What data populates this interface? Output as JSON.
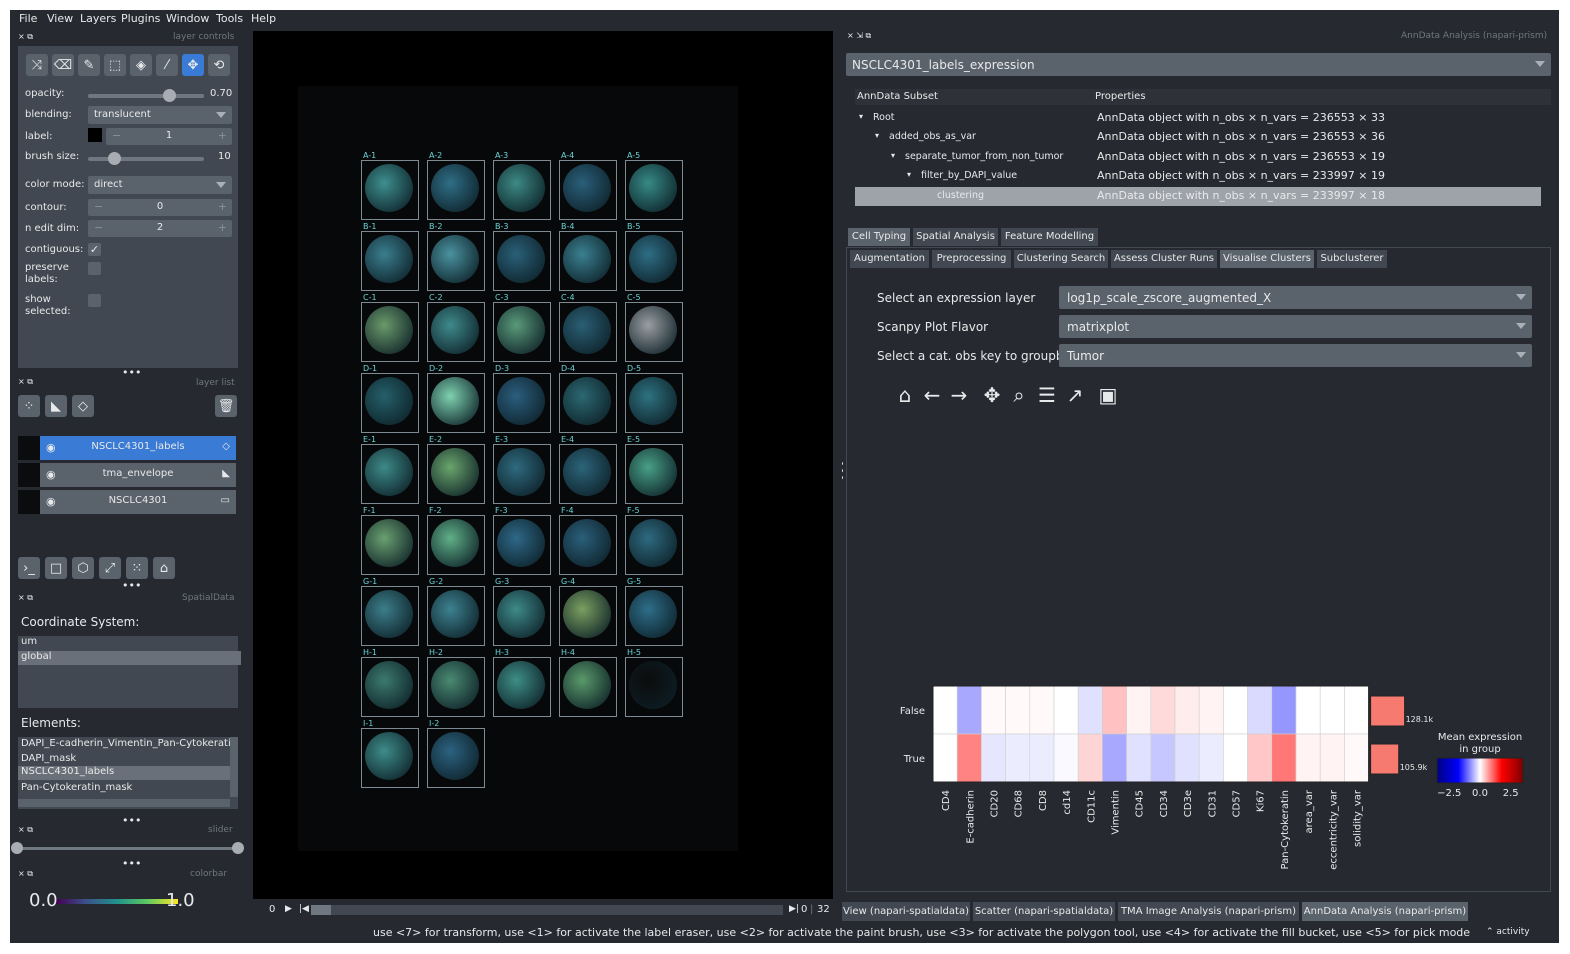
{
  "menu": [
    "File",
    "View",
    "Layers",
    "Plugins",
    "Window",
    "Tools",
    "Help"
  ],
  "layer_controls": {
    "title": "layer controls",
    "opacity_label": "opacity:",
    "opacity_value": "0.70",
    "opacity_fraction": 0.7,
    "blending_label": "blending:",
    "blending_value": "translucent",
    "label_label": "label:",
    "label_value": "1",
    "brush_label": "brush size:",
    "brush_value": "10",
    "brush_fraction": 0.22,
    "color_mode_label": "color mode:",
    "color_mode_value": "direct",
    "contour_label": "contour:",
    "contour_value": "0",
    "ndim_label": "n edit dim:",
    "ndim_value": "2",
    "contiguous_label": "contiguous:",
    "preserve_label": "preserve labels:",
    "show_selected_label": "show selected:",
    "minus": "−",
    "plus": "+",
    "check": "✓"
  },
  "layer_list": {
    "title": "layer list",
    "layers": [
      {
        "name": "NSCLC4301_labels",
        "selected": true
      },
      {
        "name": "tma_envelope",
        "selected": false
      },
      {
        "name": "NSCLC4301",
        "selected": false
      }
    ]
  },
  "spatialdata": {
    "title": "SpatialData",
    "coord_label": "Coordinate System:",
    "coords": [
      "um",
      "global"
    ],
    "elements_label": "Elements:",
    "elements": [
      "DAPI_E-cadherin_Vimentin_Pan-Cytokerati",
      "DAPI_mask",
      "NSCLC4301_labels",
      "Pan-Cytokeratin_mask"
    ]
  },
  "slider_title": "slider",
  "colorbar": {
    "title": "colorbar",
    "min": "0.0",
    "max": "1.0"
  },
  "canvas": {
    "cores": [
      {
        "l": "A-1",
        "c": "#3e8f8f"
      },
      {
        "l": "A-2",
        "c": "#2f6e86"
      },
      {
        "l": "A-3",
        "c": "#3c8a84"
      },
      {
        "l": "A-4",
        "c": "#2a5f7a"
      },
      {
        "l": "A-5",
        "c": "#368a86"
      },
      {
        "l": "B-1",
        "c": "#3a7e8e"
      },
      {
        "l": "B-2",
        "c": "#4a92a0"
      },
      {
        "l": "B-3",
        "c": "#2a6078"
      },
      {
        "l": "B-4",
        "c": "#3a8090"
      },
      {
        "l": "B-5",
        "c": "#2e6e86"
      },
      {
        "l": "C-1",
        "c": "#6a9a6a"
      },
      {
        "l": "C-2",
        "c": "#3f8a8c"
      },
      {
        "l": "C-3",
        "c": "#5a9a7a"
      },
      {
        "l": "C-4",
        "c": "#2a5f74"
      },
      {
        "l": "C-5",
        "c": "#9a9ea2"
      },
      {
        "l": "D-1",
        "c": "#25606a"
      },
      {
        "l": "D-2",
        "c": "#7ed1b0"
      },
      {
        "l": "D-3",
        "c": "#2b5e7e"
      },
      {
        "l": "D-4",
        "c": "#2c6872"
      },
      {
        "l": "D-5",
        "c": "#2e7280"
      },
      {
        "l": "E-1",
        "c": "#3d8a88"
      },
      {
        "l": "E-2",
        "c": "#6aa56c"
      },
      {
        "l": "E-3",
        "c": "#2e6a7e"
      },
      {
        "l": "E-4",
        "c": "#2c647a"
      },
      {
        "l": "E-5",
        "c": "#48a086"
      },
      {
        "l": "F-1",
        "c": "#6aa070"
      },
      {
        "l": "F-2",
        "c": "#60b088"
      },
      {
        "l": "F-3",
        "c": "#2e6888"
      },
      {
        "l": "F-4",
        "c": "#2a5f7a"
      },
      {
        "l": "F-5",
        "c": "#2e6a80"
      },
      {
        "l": "G-1",
        "c": "#3c7e8a"
      },
      {
        "l": "G-2",
        "c": "#3d8290"
      },
      {
        "l": "G-3",
        "c": "#3e8a8a"
      },
      {
        "l": "G-4",
        "c": "#7aa060"
      },
      {
        "l": "G-5",
        "c": "#2e6e8a"
      },
      {
        "l": "H-1",
        "c": "#3c7a6e"
      },
      {
        "l": "H-2",
        "c": "#4a8a72"
      },
      {
        "l": "H-3",
        "c": "#3e8e86"
      },
      {
        "l": "H-4",
        "c": "#5a9a6a"
      },
      {
        "l": "H-5",
        "c": "#0c0c0c"
      },
      {
        "l": "I-1",
        "c": "#3e8c8a"
      },
      {
        "l": "I-2",
        "c": "#2c6280"
      }
    ]
  },
  "dims": {
    "left_value": "0",
    "right_value": "0",
    "total": "32"
  },
  "right": {
    "title": "AnnData Analysis (napari-prism)",
    "selector": "NSCLC4301_labels_expression",
    "tree_headers": [
      "AnnData Subset",
      "Properties"
    ],
    "tree": [
      {
        "key": "Root",
        "prop": "AnnData object with n_obs × n_vars = 236553 × 33"
      },
      {
        "key": "added_obs_as_var",
        "prop": "AnnData object with n_obs × n_vars = 236553 × 36"
      },
      {
        "key": "separate_tumor_from_non_tumor",
        "prop": "AnnData object with n_obs × n_vars = 236553 × 19"
      },
      {
        "key": "filter_by_DAPI_value",
        "prop": "AnnData object with n_obs × n_vars = 233997 × 19"
      },
      {
        "key": "clustering",
        "prop": "AnnData object with n_obs × n_vars = 233997 × 18"
      }
    ],
    "tabs1": [
      "Cell Typing",
      "Spatial Analysis",
      "Feature Modelling"
    ],
    "tabs2": [
      "Augmentation",
      "Preprocessing",
      "Clustering Search",
      "Assess Cluster Runs",
      "Visualise Clusters",
      "Subclusterer"
    ],
    "form": [
      {
        "label": "Select an expression layer",
        "value": "log1p_scale_zscore_augmented_X"
      },
      {
        "label": "Scanpy Plot Flavor",
        "value": "matrixplot"
      },
      {
        "label": "Select a cat. obs key to groupby",
        "value": "Tumor"
      }
    ],
    "mpl_toolbar": [
      {
        "name": "home-icon",
        "glyph": "⌂"
      },
      {
        "name": "back-icon",
        "glyph": "←"
      },
      {
        "name": "forward-icon",
        "glyph": "→"
      },
      {
        "name": "pan-icon",
        "glyph": "✥"
      },
      {
        "name": "zoom-icon",
        "glyph": "⌕"
      },
      {
        "name": "subplots-icon",
        "glyph": "☰"
      },
      {
        "name": "edit-axis-icon",
        "glyph": "↗"
      },
      {
        "name": "save-icon",
        "glyph": "▣"
      }
    ]
  },
  "chart_data": {
    "type": "heatmap",
    "rows": [
      "False",
      "True"
    ],
    "columns": [
      "CD4",
      "E-cadherin",
      "CD20",
      "CD68",
      "CD8",
      "cd14",
      "CD11c",
      "Vimentin",
      "CD45",
      "CD34",
      "CD3e",
      "CD31",
      "CD57",
      "Ki67",
      "Pan-Cytokeratin",
      "area_var",
      "eccentricity_var",
      "solidity_var"
    ],
    "values": [
      [
        0.0,
        -1.4,
        0.1,
        0.1,
        0.1,
        0.0,
        -0.5,
        1.0,
        0.2,
        0.6,
        0.3,
        0.2,
        0.0,
        -0.6,
        -1.7,
        0.0,
        0.0,
        0.0
      ],
      [
        0.0,
        2.0,
        -0.4,
        -0.3,
        -0.3,
        -0.1,
        0.7,
        -1.4,
        -0.5,
        -0.9,
        -0.5,
        -0.3,
        0.0,
        0.9,
        2.2,
        0.2,
        0.2,
        0.1
      ]
    ],
    "group_counts_labels": [
      "128.1k",
      "105.9k"
    ],
    "group_counts": [
      128.1,
      105.9
    ],
    "legend_title": "Mean expression in group",
    "legend_ticks": [
      "−2.5",
      "0.0",
      "2.5"
    ],
    "vmin": -3.5,
    "vmax": 3.5
  },
  "bottom_tabs": [
    "View (napari-spatialdata)",
    "Scatter (napari-spatialdata)",
    "TMA Image Analysis (napari-prism)",
    "AnnData Analysis (napari-prism)"
  ],
  "status": {
    "text": "use <7> for transform, use <1> for activate the label eraser, use <2> for activate the paint brush, use <3> for activate the polygon tool, use <4> for activate the fill bucket, use <5> for pick mode",
    "activity": "activity"
  }
}
